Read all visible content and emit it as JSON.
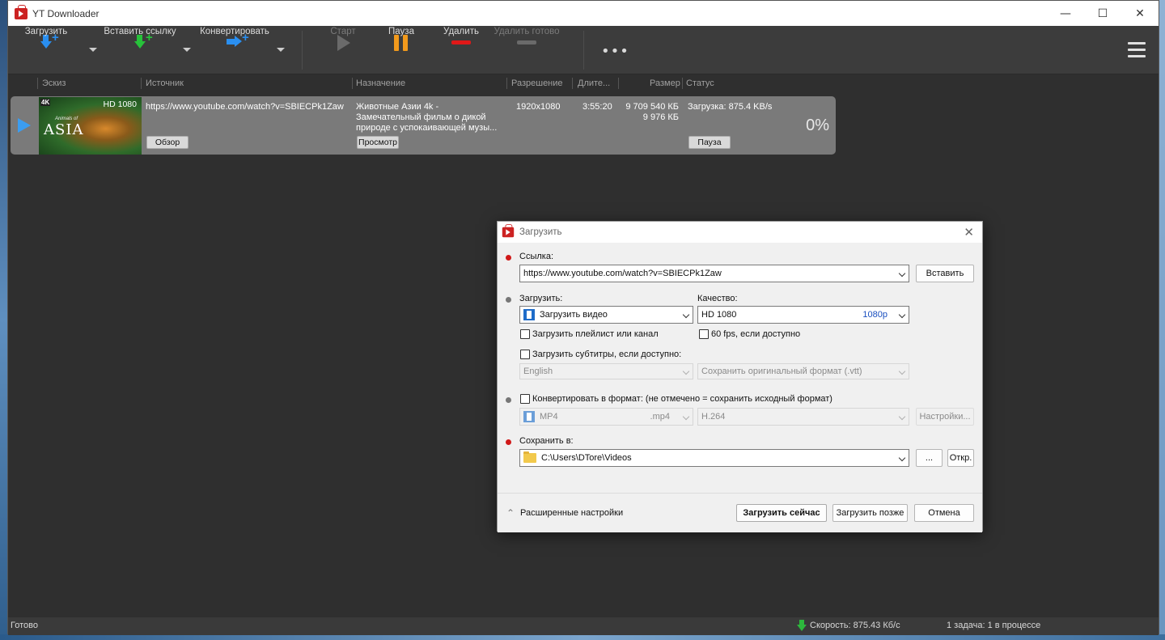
{
  "app": {
    "title": "YT Downloader",
    "window_controls": {
      "minimize": "—",
      "maximize": "☐",
      "close": "✕"
    }
  },
  "toolbar": {
    "download": "Загрузить",
    "paste_link": "Вставить ссылку",
    "convert": "Конвертировать",
    "start": "Старт",
    "pause": "Пауза",
    "delete": "Удалить",
    "delete_done": "Удалить готово",
    "more": "•••"
  },
  "list": {
    "columns": [
      "Эскиз",
      "Источник",
      "Назначение",
      "Разрешение",
      "Длите...",
      "Размер",
      "Статус"
    ],
    "items": [
      {
        "thumb_res": "HD 1080",
        "thumb_badge": "4K",
        "thumb_title": "ASIA",
        "thumb_subtitle": "Animals of",
        "source": "https://www.youtube.com/watch?v=SBIECPk1Zaw",
        "destination_1": "Животные Азии 4k -",
        "destination_2": "Замечательный фильм о дикой",
        "destination_3": "природе с успокаивающей музы...",
        "resolution": "1920x1080",
        "duration": "3:55:20",
        "size_1": "9 709 540 КБ",
        "size_2": "9 976 КБ",
        "status": "Загрузка: 875.4 KB/s",
        "percent": "0%",
        "browse_btn": "Обзор",
        "view_btn": "Просмотр",
        "pause_btn": "Пауза"
      }
    ]
  },
  "statusbar": {
    "ready": "Готово",
    "speed": "Скорость: 875.43 Кб/с",
    "tasks": "1 задача: 1 в процессе"
  },
  "dialog": {
    "title": "Загрузить",
    "link_label": "Ссылка:",
    "link_value": "https://www.youtube.com/watch?v=SBIECPk1Zaw",
    "paste_btn": "Вставить",
    "download_label": "Загрузить:",
    "download_value": "Загрузить видео",
    "quality_label": "Качество:",
    "quality_value": "HD 1080",
    "quality_badge": "1080p",
    "playlist_chk": "Загрузить плейлист или канал",
    "fps_chk": "60 fps, если доступно",
    "subs_chk": "Загрузить субтитры, если доступно:",
    "subs_lang": "English",
    "subs_format": "Сохранить оригинальный формат (.vtt)",
    "convert_chk": "Конвертировать в формат: (не отмечено = сохранить исходный формат)",
    "format_value": "MP4",
    "format_ext": ".mp4",
    "codec_value": "H.264",
    "settings_btn": "Настройки...",
    "save_label": "Сохранить в:",
    "save_path": "C:\\Users\\DTore\\Videos",
    "browse_btn": "...",
    "open_btn": "Откр.",
    "advanced": "Расширенные настройки",
    "download_now": "Загрузить сейчас",
    "download_later": "Загрузить позже",
    "cancel": "Отмена"
  },
  "colors": {
    "accent_blue": "#2a8ff0",
    "green": "#27c23a",
    "pause_orange": "#f29a1c",
    "delete_red": "#e01818",
    "required_dot": "#d01919"
  }
}
